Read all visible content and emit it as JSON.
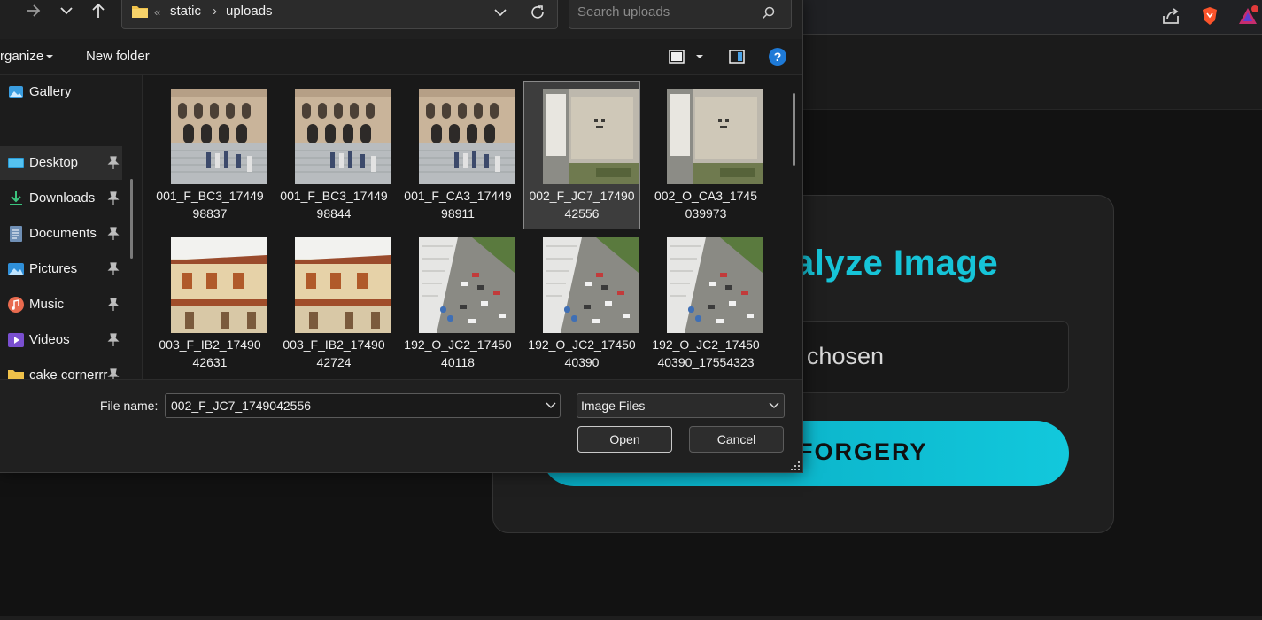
{
  "dialog": {
    "address": {
      "crumbs": [
        "static",
        "uploads"
      ]
    },
    "search": {
      "placeholder": "Search uploads"
    },
    "commands": {
      "organize": "rganize",
      "new_folder": "New folder"
    },
    "sidebar": {
      "items": [
        {
          "label": "Gallery",
          "icon": "gallery-icon",
          "pinned": false
        },
        {
          "label": "Desktop",
          "icon": "desktop-icon",
          "pinned": true,
          "selected": true
        },
        {
          "label": "Downloads",
          "icon": "download-icon",
          "pinned": true
        },
        {
          "label": "Documents",
          "icon": "document-icon",
          "pinned": true
        },
        {
          "label": "Pictures",
          "icon": "pictures-icon",
          "pinned": true
        },
        {
          "label": "Music",
          "icon": "music-icon",
          "pinned": true
        },
        {
          "label": "Videos",
          "icon": "videos-icon",
          "pinned": true
        },
        {
          "label": "cake cornerrr",
          "icon": "folder-icon",
          "pinned": true
        }
      ]
    },
    "files": [
      {
        "line1": "001_F_BC3_17449",
        "line2": "98837",
        "thumb": "building"
      },
      {
        "line1": "001_F_BC3_17449",
        "line2": "98844",
        "thumb": "building"
      },
      {
        "line1": "001_F_CA3_17449",
        "line2": "98911",
        "thumb": "building"
      },
      {
        "line1": "002_F_JC7_17490",
        "line2": "42556",
        "thumb": "aerial-roof",
        "selected": true
      },
      {
        "line1": "002_O_CA3_1745",
        "line2": "039973",
        "thumb": "aerial-roof"
      },
      {
        "line1": "003_F_IB2_17490",
        "line2": "42631",
        "thumb": "house"
      },
      {
        "line1": "003_F_IB2_17490",
        "line2": "42724",
        "thumb": "house"
      },
      {
        "line1": "192_O_JC2_17450",
        "line2": "40118",
        "thumb": "parking"
      },
      {
        "line1": "192_O_JC2_17450",
        "line2": "40390",
        "thumb": "parking"
      },
      {
        "line1": "192_O_JC2_17450",
        "line2": "40390_17554323",
        "thumb": "parking"
      }
    ],
    "file_name_label": "File name:",
    "file_name_value": "002_F_JC7_1749042556",
    "file_type": "Image Files",
    "open_label": "Open",
    "cancel_label": "Cancel"
  },
  "page": {
    "title_visible": "alyze Image",
    "file_status_visible": "chosen",
    "detect_button_visible": "FORGERY",
    "accent_color": "#16c4d8"
  }
}
